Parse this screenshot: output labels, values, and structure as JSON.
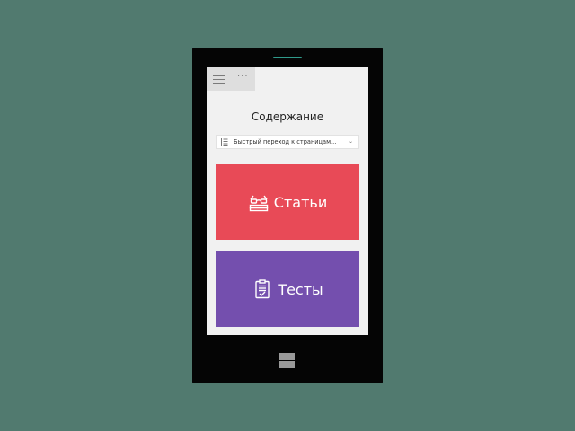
{
  "colors": {
    "background": "#517a6f",
    "phone_body": "#050505",
    "screen": "#f1f1f1",
    "articles_tile": "#e84a57",
    "tests_tile": "#744fae",
    "accent": "#2f9a8a"
  },
  "app_bar": {
    "menu_icon": "hamburger-icon",
    "more_label": "···"
  },
  "page": {
    "title": "Содержание"
  },
  "jump_select": {
    "icon": "list-icon",
    "value": "Быстрый переход к страницам...",
    "dropdown_icon": "chevron-down-icon"
  },
  "tiles": [
    {
      "label": "Статьи",
      "icon": "reading-glasses-books-icon"
    },
    {
      "label": "Тесты",
      "icon": "clipboard-check-icon"
    }
  ],
  "hardware": {
    "start_icon": "windows-logo-icon"
  }
}
